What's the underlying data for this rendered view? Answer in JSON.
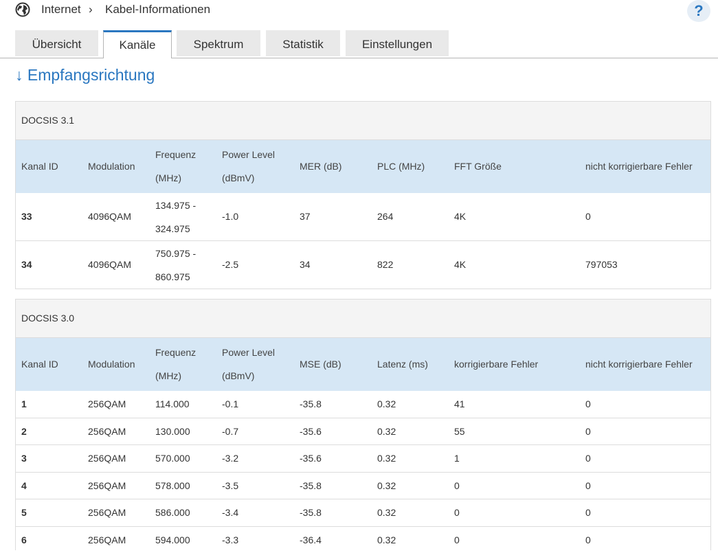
{
  "breadcrumb": {
    "root": "Internet",
    "separator": "›",
    "current": "Kabel-Informationen",
    "globe_icon": "globe-icon",
    "help_label": "?"
  },
  "tabs": [
    {
      "label": "Übersicht",
      "active": false
    },
    {
      "label": "Kanäle",
      "active": true
    },
    {
      "label": "Spektrum",
      "active": false
    },
    {
      "label": "Statistik",
      "active": false
    },
    {
      "label": "Einstellungen",
      "active": false
    }
  ],
  "section_title": "↓ Empfangsrichtung",
  "docsis31": {
    "title": "DOCSIS 3.1",
    "headers": {
      "kanal_id": "Kanal ID",
      "modulation": "Modulation",
      "frequenz_1": "Frequenz",
      "frequenz_2": "(MHz)",
      "power_1": "Power Level",
      "power_2": "(dBmV)",
      "mer": "MER (dB)",
      "plc": "PLC (MHz)",
      "fft": "FFT Größe",
      "nkf": "nicht korrigierbare Fehler"
    },
    "rows": [
      {
        "id": "33",
        "modulation": "4096QAM",
        "freq_1": "134.975 -",
        "freq_2": "324.975",
        "power": "-1.0",
        "mer": "37",
        "plc": "264",
        "fft": "4K",
        "nkf": "0"
      },
      {
        "id": "34",
        "modulation": "4096QAM",
        "freq_1": "750.975 -",
        "freq_2": "860.975",
        "power": "-2.5",
        "mer": "34",
        "plc": "822",
        "fft": "4K",
        "nkf": "797053"
      }
    ]
  },
  "docsis30": {
    "title": "DOCSIS 3.0",
    "headers": {
      "kanal_id": "Kanal ID",
      "modulation": "Modulation",
      "frequenz_1": "Frequenz",
      "frequenz_2": "(MHz)",
      "power_1": "Power Level",
      "power_2": "(dBmV)",
      "mse": "MSE (dB)",
      "latenz": "Latenz (ms)",
      "kf": "korrigierbare Fehler",
      "nkf": "nicht korrigierbare Fehler"
    },
    "rows": [
      {
        "id": "1",
        "modulation": "256QAM",
        "freq": "114.000",
        "power": "-0.1",
        "mse": "-35.8",
        "latenz": "0.32",
        "kf": "41",
        "nkf": "0"
      },
      {
        "id": "2",
        "modulation": "256QAM",
        "freq": "130.000",
        "power": "-0.7",
        "mse": "-35.6",
        "latenz": "0.32",
        "kf": "55",
        "nkf": "0"
      },
      {
        "id": "3",
        "modulation": "256QAM",
        "freq": "570.000",
        "power": "-3.2",
        "mse": "-35.6",
        "latenz": "0.32",
        "kf": "1",
        "nkf": "0"
      },
      {
        "id": "4",
        "modulation": "256QAM",
        "freq": "578.000",
        "power": "-3.5",
        "mse": "-35.8",
        "latenz": "0.32",
        "kf": "0",
        "nkf": "0"
      },
      {
        "id": "5",
        "modulation": "256QAM",
        "freq": "586.000",
        "power": "-3.4",
        "mse": "-35.8",
        "latenz": "0.32",
        "kf": "0",
        "nkf": "0"
      },
      {
        "id": "6",
        "modulation": "256QAM",
        "freq": "594.000",
        "power": "-3.3",
        "mse": "-36.4",
        "latenz": "0.32",
        "kf": "0",
        "nkf": "0"
      }
    ]
  }
}
